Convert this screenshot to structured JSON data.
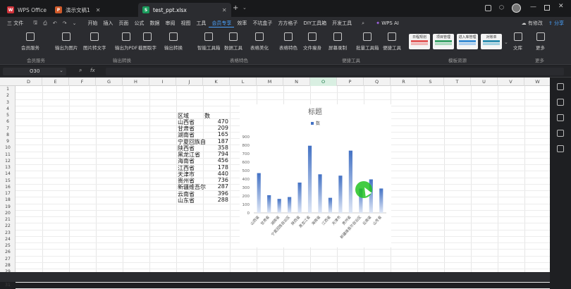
{
  "titlebar": {
    "tabs": [
      {
        "label": "WPS Office",
        "icon": "wps-logo-icon",
        "color": "#d0323a"
      },
      {
        "label": "演示文稿1",
        "icon": "presentation-icon",
        "color": "#d05a2a"
      },
      {
        "label": "test_ppt.xlsx",
        "icon": "spreadsheet-icon",
        "color": "#1a9b5c"
      }
    ]
  },
  "menubar": {
    "file": "三 文件",
    "items": [
      "开始",
      "插入",
      "页面",
      "公式",
      "数据",
      "审阅",
      "视图",
      "工具",
      "会员专享",
      "效率",
      "不坑盒子",
      "方方格子",
      "DIY工具箱",
      "开发工具"
    ],
    "active": "会员专享",
    "wps_ai": "WPS AI",
    "edit_status": "有修改",
    "share": "分享"
  },
  "ribbon": {
    "buttons": [
      "会员服务",
      "输出为图片",
      "图片转文字",
      "输出为PDF",
      "截图取字",
      "输出转换",
      "智能工具箱",
      "数据工具",
      "表格美化",
      "表格特色",
      "文件瘦身",
      "屏幕录制",
      "批量工具箱",
      "便捷工具",
      "文库",
      "更多"
    ],
    "groups": [
      "会员服务",
      "输出转换",
      "表格特色",
      "便捷工具",
      "模板资源",
      "更多"
    ],
    "templates": [
      "日程规划",
      "项目管理",
      "进入库管理",
      "对账单"
    ]
  },
  "formulabar": {
    "cell_ref": "O30",
    "fx": "fx"
  },
  "sheet": {
    "columns": [
      "D",
      "E",
      "F",
      "G",
      "H",
      "I",
      "J",
      "K",
      "L",
      "M",
      "N",
      "O",
      "P",
      "Q",
      "R",
      "S",
      "T",
      "U",
      "V",
      "W"
    ],
    "selected_column": "O",
    "rows": [
      "1",
      "2",
      "3",
      "4",
      "5",
      "6",
      "7",
      "8",
      "9",
      "10",
      "11",
      "12",
      "13",
      "14",
      "15",
      "16",
      "17",
      "18",
      "19",
      "20",
      "21",
      "22",
      "23",
      "24",
      "25",
      "26",
      "27",
      "28",
      "29",
      "30",
      "31"
    ],
    "header": [
      "区域",
      "数"
    ],
    "data": [
      [
        "山西省",
        "470"
      ],
      [
        "甘肃省",
        "209"
      ],
      [
        "湖南省",
        "165"
      ],
      [
        "宁夏回族自",
        "187"
      ],
      [
        "陕西省",
        "358"
      ],
      [
        "黑龙江省",
        "794"
      ],
      [
        "海南省",
        "456"
      ],
      [
        "江西省",
        "178"
      ],
      [
        "天津市",
        "440"
      ],
      [
        "贵州省",
        "736"
      ],
      [
        "新疆维吾尔",
        "287"
      ],
      [
        "云南省",
        "396"
      ],
      [
        "山东省",
        "288"
      ]
    ]
  },
  "chart_data": {
    "type": "bar",
    "title": "标题",
    "legend": [
      "数"
    ],
    "legend_position": "top",
    "categories": [
      "山西省",
      "甘肃省",
      "湖南省",
      "宁夏回族自治区",
      "陕西省",
      "黑龙江省",
      "海南省",
      "江西省",
      "天津市",
      "贵州省",
      "新疆维吾尔自治区",
      "云南省",
      "山东省"
    ],
    "series": [
      {
        "name": "数",
        "values": [
          470,
          209,
          165,
          187,
          358,
          794,
          456,
          178,
          440,
          736,
          287,
          396,
          288
        ]
      }
    ],
    "ylim": [
      0,
      900
    ],
    "yticks": [
      "0",
      "100",
      "200",
      "300",
      "400",
      "500",
      "600",
      "700",
      "800",
      "900"
    ],
    "grid": false,
    "bar_color": "#4472c4"
  },
  "cursor": {
    "color": "#22c322"
  }
}
